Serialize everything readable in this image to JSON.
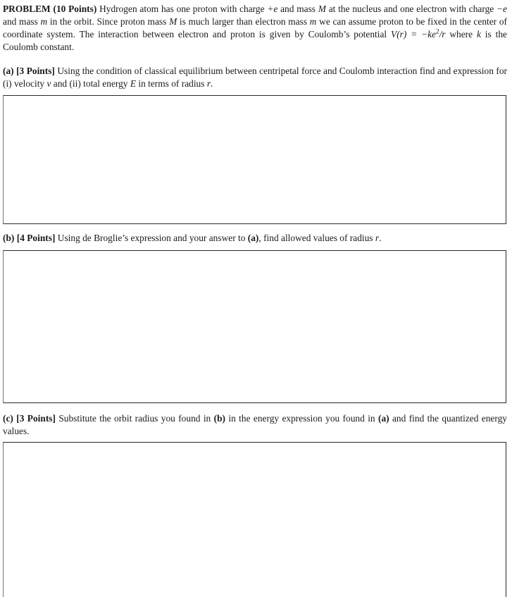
{
  "problem": {
    "heading": "PROBLEM (10 Points)",
    "text_1": " Hydrogen atom has one proton with charge ",
    "charge_plus": "+e",
    "text_2": " and mass ",
    "M": "M",
    "text_3": " at the nucleus and one electron with charge ",
    "charge_minus": "−e",
    "text_4": " and mass ",
    "m": "m",
    "text_5": " in the orbit. Since proton mass ",
    "text_6": " is much larger than electron mass ",
    "text_7": " we can assume proton to be fixed in the center of coordinate system. The interaction between electron and proton is given by Coulomb’s potential ",
    "potential_lhs": "V(r) = −ke",
    "potential_exp": "2",
    "potential_rhs": "/r",
    "text_8": " where ",
    "k": "k",
    "text_9": " is the Coulomb constant."
  },
  "parts": [
    {
      "label": "(a)",
      "points": "[3 Points]",
      "text_1": " Using the condition of classical equilibrium between centripetal force and Coulomb interaction find and expression for (i) velocity ",
      "v": "v",
      "text_2": " and (ii) total energy ",
      "E": "E",
      "text_3": " in terms of radius ",
      "r": "r",
      "text_4": ".",
      "answer": ""
    },
    {
      "label": "(b)",
      "points": "[4 Points]",
      "text_1": " Using de Broglie’s expression and your answer to ",
      "ref": "(a)",
      "text_2": ", find allowed values of radius ",
      "r": "r",
      "text_3": ".",
      "answer": ""
    },
    {
      "label": "(c)",
      "points": "[3 Points]",
      "text_1": " Substitute the orbit radius you found in ",
      "ref1": "(b)",
      "text_2": " in the energy expression you found in ",
      "ref2": "(a)",
      "text_3": " and find the quantized energy values.",
      "answer": ""
    }
  ]
}
